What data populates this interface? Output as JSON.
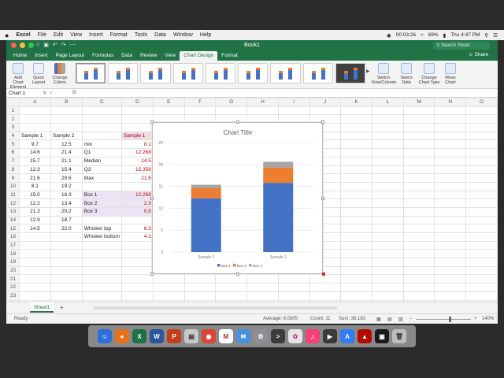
{
  "menubar": {
    "apple": "",
    "items": [
      "Excel",
      "File",
      "Edit",
      "View",
      "Insert",
      "Format",
      "Tools",
      "Data",
      "Window",
      "Help"
    ],
    "timer": "00:03:26",
    "battery": "69%",
    "clock": "Thu 4:47 PM"
  },
  "window": {
    "title": "Book1",
    "search_placeholder": "Search Sheet",
    "share": "Share"
  },
  "tabs": [
    "Home",
    "Insert",
    "Page Layout",
    "Formulas",
    "Data",
    "Review",
    "View",
    "Chart Design",
    "Format"
  ],
  "active_tab": "Chart Design",
  "ribbon": {
    "add_chart_element": "Add Chart Element",
    "quick_layout": "Quick Layout",
    "change_colors": "Change Colors",
    "switch_row_column": "Switch Row/Column",
    "select_data": "Select Data",
    "change_chart_type": "Change Chart Type",
    "move_chart": "Move Chart"
  },
  "formula_bar": {
    "name_box": "Chart 1",
    "fx": "fx"
  },
  "columns": [
    "A",
    "B",
    "C",
    "D",
    "E",
    "F",
    "G",
    "H",
    "I",
    "J",
    "K",
    "L",
    "M",
    "N",
    "O"
  ],
  "rows": [
    [
      "",
      "",
      "",
      "",
      ""
    ],
    [
      "",
      "",
      "",
      "",
      ""
    ],
    [
      "",
      "",
      "",
      "",
      ""
    ],
    [
      "Sample 1",
      "Sample 2",
      "",
      "Sample 1",
      "Samp"
    ],
    [
      "9.7",
      "12.5",
      "min",
      "8.1",
      ""
    ],
    [
      "14.6",
      "21.4",
      "Q1",
      "12.268",
      "1"
    ],
    [
      "15.7",
      "21.1",
      "Median",
      "14.5",
      ""
    ],
    [
      "12.3",
      "15.4",
      "Q3",
      "15.358",
      ""
    ],
    [
      "21.6",
      "20.6",
      "Max",
      "21.6",
      ""
    ],
    [
      "8.1",
      "19.2",
      "",
      "",
      ""
    ],
    [
      "15.0",
      "16.3",
      "Box 1",
      "12.268",
      "1"
    ],
    [
      "12.2",
      "13.4",
      "Box 2",
      "2.3",
      ""
    ],
    [
      "21.3",
      "20.2",
      "Box 3",
      "0.8",
      ""
    ],
    [
      "12.9",
      "18.7",
      "",
      "",
      ""
    ],
    [
      "14.5",
      "22.0",
      "Whisker top",
      "6.3",
      ""
    ],
    [
      "",
      "",
      "Whisker bottom",
      "4.1",
      ""
    ],
    [
      "",
      "",
      "",
      "",
      ""
    ],
    [
      "",
      "",
      "",
      "",
      ""
    ],
    [
      "",
      "",
      "",
      "",
      ""
    ],
    [
      "",
      "",
      "",
      "",
      ""
    ],
    [
      "",
      "",
      "",
      "",
      ""
    ],
    [
      "",
      "",
      "",
      "",
      ""
    ],
    [
      "",
      "",
      "",
      "",
      ""
    ],
    [
      "",
      "",
      "",
      "",
      ""
    ]
  ],
  "sheet_tabs": [
    "Sheet1"
  ],
  "status": {
    "ready": "Ready",
    "average": "Average: 6.0305",
    "count": "Count: 11",
    "sum": "Sum: 36.183",
    "zoom": "140%"
  },
  "chart_data": {
    "type": "bar",
    "stacked": true,
    "title": "Chart Title",
    "categories": [
      "Sample 1",
      "Sample 2"
    ],
    "series": [
      {
        "name": "Box 1",
        "values": [
          12.268,
          15.8
        ],
        "color": "#4472c4"
      },
      {
        "name": "Box 2",
        "values": [
          2.3,
          3.5
        ],
        "color": "#ed7d31"
      },
      {
        "name": "Box 3",
        "values": [
          0.8,
          1.3
        ],
        "color": "#a5a5a5"
      }
    ],
    "yticks": [
      "0",
      "5",
      "10",
      "15",
      "20",
      "25"
    ],
    "ylim": [
      0,
      25
    ],
    "legend": "bottom",
    "grid": true
  },
  "colors": {
    "excel_green": "#217346",
    "box1": "#4472c4",
    "box2": "#ed7d31",
    "box3": "#a5a5a5"
  }
}
